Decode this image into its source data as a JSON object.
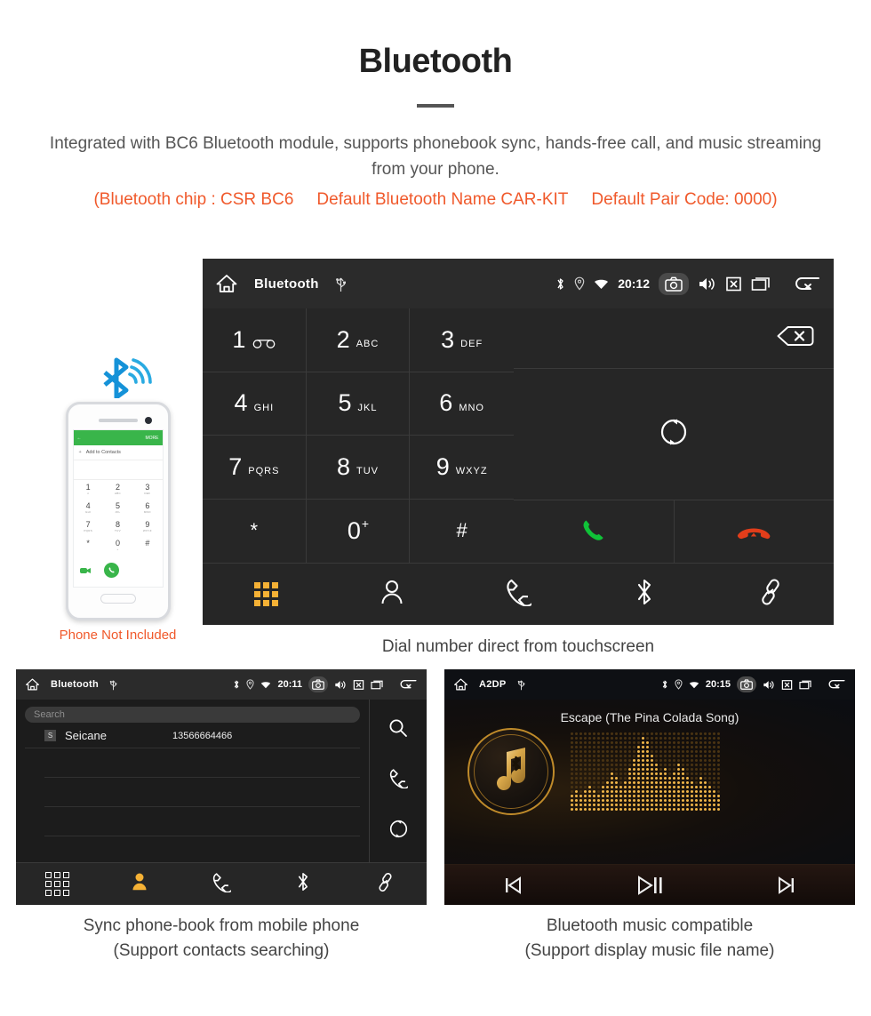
{
  "header": {
    "title": "Bluetooth",
    "intro": "Integrated with BC6 Bluetooth module, supports phonebook sync, hands-free call, and music streaming from your phone.",
    "spec_open": "(Bluetooth chip : CSR BC6",
    "spec_name": "Default Bluetooth Name CAR-KIT",
    "spec_pair": "Default Pair Code: 0000)",
    "accent_color": "#f0592b",
    "title_color": "#222222"
  },
  "main_screen": {
    "statusbar": {
      "home_icon": "home-icon",
      "title": "Bluetooth",
      "usb_icon": "usb-icon",
      "bluetooth_icon": "bluetooth-icon",
      "location_icon": "location-icon",
      "wifi_icon": "wifi-icon",
      "time": "20:12",
      "camera_icon": "camera-icon",
      "volume_icon": "speaker-icon",
      "mute_icon": "mute-box-icon",
      "recents_icon": "recents-icon",
      "back_icon": "back-arrow-icon"
    },
    "keys": [
      {
        "digit": "1",
        "letters": "",
        "voicemail": true
      },
      {
        "digit": "2",
        "letters": "ABC"
      },
      {
        "digit": "3",
        "letters": "DEF"
      },
      {
        "digit": "4",
        "letters": "GHI"
      },
      {
        "digit": "5",
        "letters": "JKL"
      },
      {
        "digit": "6",
        "letters": "MNO"
      },
      {
        "digit": "7",
        "letters": "PQRS"
      },
      {
        "digit": "8",
        "letters": "TUV"
      },
      {
        "digit": "9",
        "letters": "WXYZ"
      },
      {
        "digit": "*",
        "letters": ""
      },
      {
        "digit": "0",
        "letters": "",
        "plus": "+"
      },
      {
        "digit": "#",
        "letters": ""
      }
    ],
    "number_value": "",
    "backspace_icon": "backspace-icon",
    "sync_icon": "sync-icon",
    "call_icon": "call-icon",
    "hangup_icon": "hangup-icon",
    "call_color": "#10c238",
    "hangup_color": "#e23d1a",
    "tabs": [
      {
        "name": "dialpad",
        "icon": "dialpad-icon",
        "active": true
      },
      {
        "name": "contacts",
        "icon": "person-icon",
        "active": false
      },
      {
        "name": "call-log",
        "icon": "handset-icon",
        "active": false
      },
      {
        "name": "bluetooth",
        "icon": "bluetooth-icon",
        "active": false
      },
      {
        "name": "pair",
        "icon": "link-icon",
        "active": false
      }
    ],
    "active_color": "#f5b135",
    "caption": "Dial number direct from touchscreen"
  },
  "phone_illustration": {
    "bluetooth_wave_icon": "bluetooth-signal-icon",
    "screen_more_label": "MORE",
    "back_label": "←",
    "add_contacts_label": "Add to Contacts",
    "keys": [
      {
        "digit": "1",
        "letters": "∞"
      },
      {
        "digit": "2",
        "letters": "ABC"
      },
      {
        "digit": "3",
        "letters": "DEF"
      },
      {
        "digit": "4",
        "letters": "GHI"
      },
      {
        "digit": "5",
        "letters": "JKL"
      },
      {
        "digit": "6",
        "letters": "MNO"
      },
      {
        "digit": "7",
        "letters": "PQRS"
      },
      {
        "digit": "8",
        "letters": "TUV"
      },
      {
        "digit": "9",
        "letters": "WXYZ"
      },
      {
        "digit": "*",
        "letters": ""
      },
      {
        "digit": "0",
        "letters": "+"
      },
      {
        "digit": "#",
        "letters": ""
      }
    ],
    "note": "Phone Not Included",
    "note_color": "#f0592b"
  },
  "phonebook_screen": {
    "statusbar": {
      "title": "Bluetooth",
      "time": "20:11"
    },
    "search_placeholder": "Search",
    "search_value": "",
    "contacts": [
      {
        "initial": "S",
        "name": "Seicane",
        "number": "13566664466"
      }
    ],
    "side_icons": [
      {
        "name": "search-icon"
      },
      {
        "name": "handset-icon"
      },
      {
        "name": "sync-icon"
      }
    ],
    "tabs": [
      {
        "name": "dialpad",
        "icon": "dialpad-icon",
        "active": false
      },
      {
        "name": "contacts",
        "icon": "person-icon",
        "active": true
      },
      {
        "name": "call-log",
        "icon": "handset-icon",
        "active": false
      },
      {
        "name": "bluetooth",
        "icon": "bluetooth-icon",
        "active": false
      },
      {
        "name": "pair",
        "icon": "link-icon",
        "active": false
      }
    ],
    "caption_line1": "Sync phone-book from mobile phone",
    "caption_line2": "(Support contacts searching)"
  },
  "music_screen": {
    "statusbar": {
      "title": "A2DP",
      "time": "20:15"
    },
    "track_title": "Escape (The Pina Colada Song)",
    "album_icon": "bluetooth-music-note-icon",
    "controls": [
      {
        "name": "previous-track",
        "icon": "skip-previous-icon"
      },
      {
        "name": "play-pause",
        "icon": "play-pause-icon"
      },
      {
        "name": "next-track",
        "icon": "skip-next-icon"
      }
    ],
    "caption_line1": "Bluetooth music compatible",
    "caption_line2": "(Support display music file name)"
  }
}
